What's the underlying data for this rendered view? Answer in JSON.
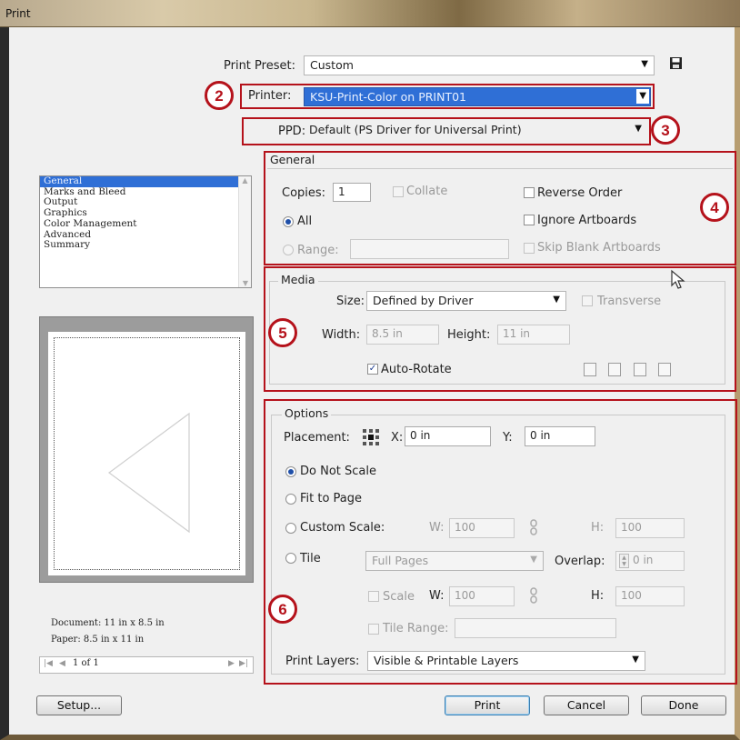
{
  "window": {
    "title": "Print"
  },
  "print_preset": {
    "label": "Print Preset:",
    "value": "Custom"
  },
  "printer": {
    "label": "Printer:",
    "value": "KSU-Print-Color on PRINT01"
  },
  "ppd": {
    "label": "PPD:",
    "value": "Default (PS Driver for Universal Print)"
  },
  "callouts": [
    "2",
    "3",
    "4",
    "5",
    "6"
  ],
  "sidebar": {
    "items": [
      "General",
      "Marks and Bleed",
      "Output",
      "Graphics",
      "Color Management",
      "Advanced",
      "Summary"
    ],
    "selected_index": 0
  },
  "preview": {
    "document": "Document: 11 in x 8.5 in",
    "paper": "Paper: 8.5 in x 11 in",
    "page_field": "1 of 1"
  },
  "general": {
    "title": "General",
    "copies_label": "Copies:",
    "copies_value": "1",
    "collate": "Collate",
    "reverse_order": "Reverse Order",
    "all": "All",
    "ignore_artboards": "Ignore Artboards",
    "range": "Range:",
    "range_value": "",
    "skip_blank": "Skip Blank Artboards"
  },
  "media": {
    "title": "Media",
    "size_label": "Size:",
    "size_value": "Defined by Driver",
    "transverse": "Transverse",
    "width_label": "Width:",
    "width_value": "8.5 in",
    "height_label": "Height:",
    "height_value": "11 in",
    "auto_rotate": "Auto-Rotate",
    "auto_rotate_checked": true
  },
  "options": {
    "title": "Options",
    "placement_label": "Placement:",
    "x_label": "X:",
    "x_value": "0 in",
    "y_label": "Y:",
    "y_value": "0 in",
    "do_not_scale": "Do Not Scale",
    "fit_to_page": "Fit to Page",
    "custom_scale": "Custom Scale:",
    "w_label": "W:",
    "w_value": "100",
    "h_label": "H:",
    "h_value": "100",
    "tile": "Tile",
    "tile_value": "Full Pages",
    "overlap_label": "Overlap:",
    "overlap_value": "0 in",
    "scale": "Scale",
    "scale_w_label": "W:",
    "scale_w_value": "100",
    "scale_h_label": "H:",
    "scale_h_value": "100",
    "tile_range": "Tile Range:",
    "tile_range_value": "",
    "print_layers_label": "Print Layers:",
    "print_layers_value": "Visible & Printable Layers"
  },
  "buttons": {
    "setup": "Setup...",
    "print": "Print",
    "cancel": "Cancel",
    "done": "Done"
  },
  "colors": {
    "callout_red": "#b5121b",
    "selection_blue": "#2f6fd6"
  }
}
